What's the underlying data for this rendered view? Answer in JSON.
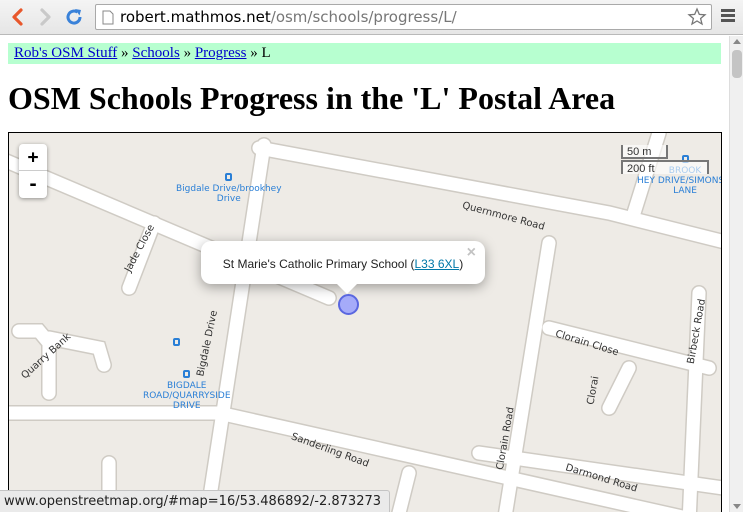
{
  "browser": {
    "url_host": "robert.mathmos.net",
    "url_path": "/osm/schools/progress/L/",
    "status_url": "www.openstreetmap.org/#map=16/53.486892/-2.873273"
  },
  "breadcrumb": {
    "items": [
      "Rob's OSM Stuff",
      "Schools",
      "Progress"
    ],
    "current": "L",
    "separator": "»"
  },
  "page": {
    "title": "OSM Schools Progress in the 'L' Postal Area"
  },
  "map": {
    "zoom_in": "+",
    "zoom_out": "-",
    "scale_metric": "50 m",
    "scale_imperial": "200 ft",
    "popup": {
      "text_prefix": "St Marie's Catholic Primary School (",
      "postcode": "L33 6XL",
      "text_suffix": ")",
      "close": "×"
    },
    "street_labels": {
      "quernmore": "Quernmore Road",
      "jade": "Jade Close",
      "quarry_bank": "Quarry Bank",
      "bigdale": "Bigdale Drive",
      "sanderling": "Sanderling Road",
      "clorain_road": "Clorain Road",
      "clorain_close": "Clorain Close",
      "clorain_short": "Clorai",
      "birbeck": "Birbeck Road",
      "darmond": "Darmond Road"
    },
    "bus_stops": {
      "brookhey": [
        "Bigdale Drive/brookhey",
        "Drive"
      ],
      "quarryside": [
        "BIGDALE",
        "ROAD/QUARRYSIDE",
        "DRIVE"
      ],
      "simonsw": [
        "BROOK",
        "HEY DRIVE/SIMONSW",
        "LANE"
      ]
    }
  },
  "colors": {
    "breadcrumb_bg": "#b7ffd0",
    "map_bg": "#eeebe6",
    "road": "#ffffff",
    "link": "#0000cc",
    "bus": "#2a7fd6",
    "marker": "#8c96ff"
  }
}
